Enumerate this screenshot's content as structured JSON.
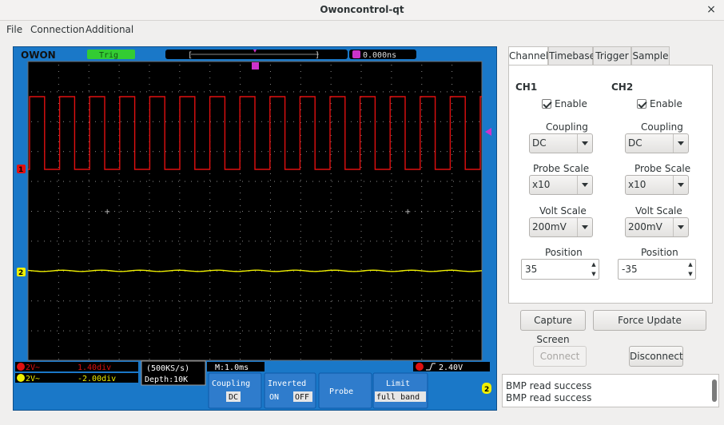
{
  "window": {
    "title": "Owoncontrol-qt",
    "close_glyph": "×"
  },
  "menu": {
    "file": "File",
    "connection": "Connection",
    "additional": "Additional"
  },
  "scope": {
    "brand": "OWON",
    "trig_status": "Trig",
    "trig_time": "0.000ns",
    "ch1_scale": "2V~",
    "ch1_offset": "1.40div",
    "ch2_scale": "2V~",
    "ch2_offset": "-2.00div",
    "sample_rate": "(500KS/s)",
    "depth": "Depth:10K",
    "timebase": "M:1.0ms",
    "trig_level": "2.40V",
    "soft_menu": {
      "coupling_label": "Coupling",
      "coupling_value": "DC",
      "inverted_label": "Inverted",
      "inverted_on": "ON",
      "inverted_off": "OFF",
      "probe_label": "Probe",
      "limit_label": "Limit",
      "limit_value": "full band"
    },
    "colors": {
      "ch1": "#e01010",
      "ch2": "#f0f000",
      "trigger": "#cc33cc",
      "frame": "#1a78c8",
      "screen": "#000000"
    }
  },
  "tabs": [
    "Channel",
    "Timebase",
    "Trigger",
    "Sample"
  ],
  "channel": {
    "ch1": {
      "header": "CH1",
      "enable_label": "Enable",
      "coupling_label": "Coupling",
      "coupling": "DC",
      "probe_label": "Probe Scale",
      "probe": "x10",
      "volt_label": "Volt Scale",
      "volt": "200mV",
      "position_label": "Position",
      "position": "35"
    },
    "ch2": {
      "header": "CH2",
      "enable_label": "Enable",
      "coupling_label": "Coupling",
      "coupling": "DC",
      "probe_label": "Probe Scale",
      "probe": "x10",
      "volt_label": "Volt Scale",
      "volt": "200mV",
      "position_label": "Position",
      "position": "-35"
    }
  },
  "buttons": {
    "capture": "Capture Screen",
    "force": "Force Update",
    "connect": "Connect",
    "disconnect": "Disconnect"
  },
  "log": [
    "BMP read success",
    "BMP read success"
  ]
}
